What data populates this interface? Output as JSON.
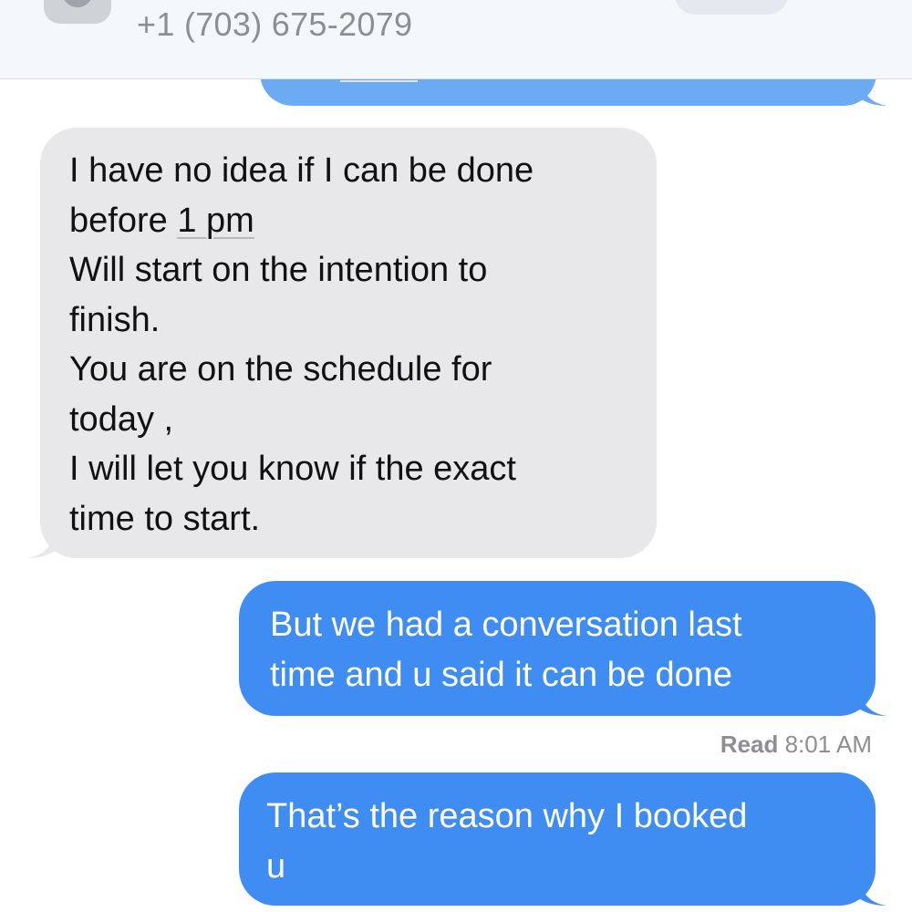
{
  "header": {
    "contact_number": "+1 (703) 675-2079"
  },
  "messages": [
    {
      "direction": "received",
      "lines": [
        "I have no idea if I can be done",
        "before",
        "1 pm",
        "Will start on the intention to",
        "finish.",
        "You are on the schedule for",
        "today ,",
        "I will let you know if the exact",
        "time to start."
      ]
    },
    {
      "direction": "sent",
      "lines": [
        "But we had a conversation last",
        "time and u said it can be done"
      ]
    },
    {
      "direction": "sent",
      "lines": [
        "That’s the reason why I booked",
        "u"
      ]
    }
  ],
  "read_receipt": {
    "label": "Read",
    "time": "8:01 AM"
  },
  "colors": {
    "sent_bubble": "#3f8cf3",
    "received_bubble": "#e8e8eb",
    "header_background": "#f3f8fb"
  }
}
